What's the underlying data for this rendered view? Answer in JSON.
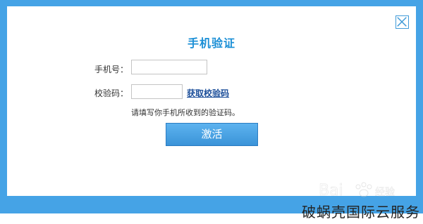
{
  "dialog": {
    "title": "手机验证",
    "phone_label": "手机号：",
    "phone_value": "",
    "code_label": "校验码：",
    "code_value": "",
    "get_code_link": "获取校验码",
    "hint": "请填写你手机所收到的验证码。",
    "activate_button": "激活"
  },
  "icons": {
    "close": "close-icon",
    "baidu": "baidu-paw-watermark-icon"
  },
  "colors": {
    "frame": "#45a3e6",
    "title": "#1b8fd6",
    "link": "#1d4f9a",
    "button": "#3a93d8"
  },
  "watermark": {
    "brand_text": "破蜗壳国际云服务"
  }
}
